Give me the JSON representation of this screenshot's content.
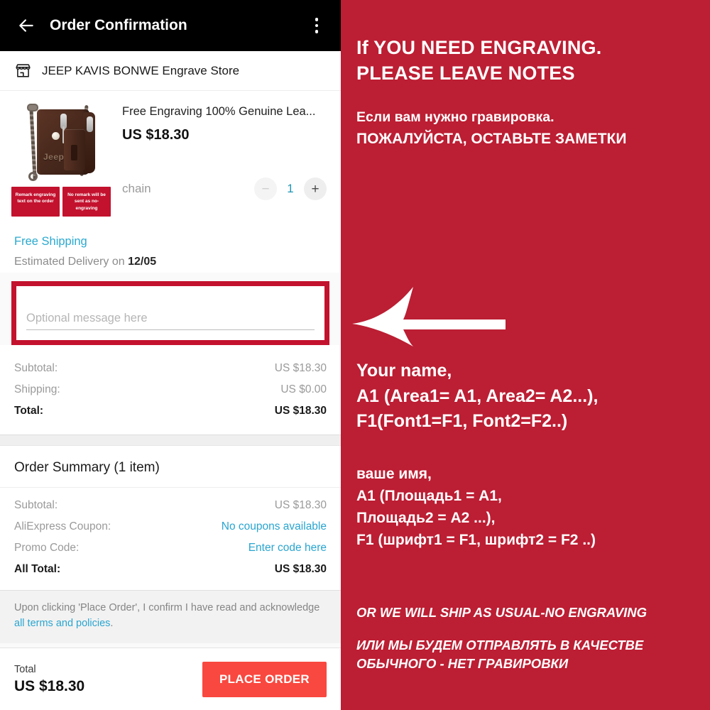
{
  "appbar": {
    "back_icon": "arrow-left-icon",
    "title": "Order Confirmation",
    "overflow_icon": "more-vertical-icon"
  },
  "store": {
    "icon": "storefront-icon",
    "name": "JEEP KAVIS BONWE Engrave Store"
  },
  "product": {
    "image_alt": "brown-leather-wallet-with-chain",
    "brand_stamp": "Jeep",
    "banners": [
      "Remark engraving text on the order",
      "No remark will be sent as no-engraving"
    ],
    "title": "Free Engraving 100% Genuine Lea...",
    "price": "US $18.30",
    "variant": "chain",
    "quantity": "1",
    "minus_label": "−",
    "plus_label": "+"
  },
  "shipping": {
    "free_label": "Free Shipping",
    "eta_prefix": "Estimated Delivery on",
    "eta_date": "12/05"
  },
  "message": {
    "placeholder": "Optional message here",
    "value": ""
  },
  "totals": {
    "rows": [
      {
        "label": "Subtotal:",
        "value": "US $18.30"
      },
      {
        "label": "Shipping:",
        "value": "US $0.00"
      }
    ],
    "total_label": "Total:",
    "total_value": "US $18.30"
  },
  "summary": {
    "title": "Order Summary (1 item)",
    "rows": [
      {
        "label": "Subtotal:",
        "value": "US $18.30"
      },
      {
        "label": "AliExpress Coupon:",
        "value": "No coupons available"
      },
      {
        "label": "Promo Code:",
        "value": "Enter code here"
      }
    ],
    "all_total_label": "All Total:",
    "all_total_value": "US $18.30"
  },
  "terms": {
    "text_before": "Upon clicking 'Place Order', I confirm I have read and acknowledge ",
    "link": "all terms and policies",
    "text_after": "."
  },
  "bottombar": {
    "total_label": "Total",
    "total_value": "US $18.30",
    "place_order_label": "PLACE ORDER"
  },
  "promo": {
    "heading_line1": "If YOU NEED ENGRAVING.",
    "heading_line2": "PLEASE LEAVE NOTES",
    "ru_line1": "Если вам нужно гравировка.",
    "ru_line2": "ПОЖАЛУЙСТА, ОСТАВЬТЕ ЗАМЕТКИ",
    "arrow_icon": "arrow-left-large-icon",
    "format_line1": "Your name,",
    "format_line2": "A1  (Area1= A1, Area2= A2...),",
    "format_line3": "F1(Font1=F1, Font2=F2..)",
    "format_ru_line1": "ваше имя,",
    "format_ru_line2": "A1 (Площадь1 = A1,",
    "format_ru_line3": "Площадь2 = A2 ...),",
    "format_ru_line4": "F1 (шрифт1 = F1, шрифт2 = F2 ..)",
    "footer_en": "OR WE WILL SHIP AS USUAL-NO ENGRAVING",
    "footer_ru_line1": "ИЛИ МЫ БУДЕМ ОТПРАВЛЯТЬ В КАЧЕСТВЕ",
    "footer_ru_line2": "ОБЫЧНОГО - НЕТ ГРАВИРОВКИ"
  },
  "colors": {
    "promo_red": "#bc1e33",
    "banner_red": "#c3122e",
    "place_order_red": "#f9483f",
    "link_blue": "#29a5d0",
    "appbar_black": "#000000"
  }
}
